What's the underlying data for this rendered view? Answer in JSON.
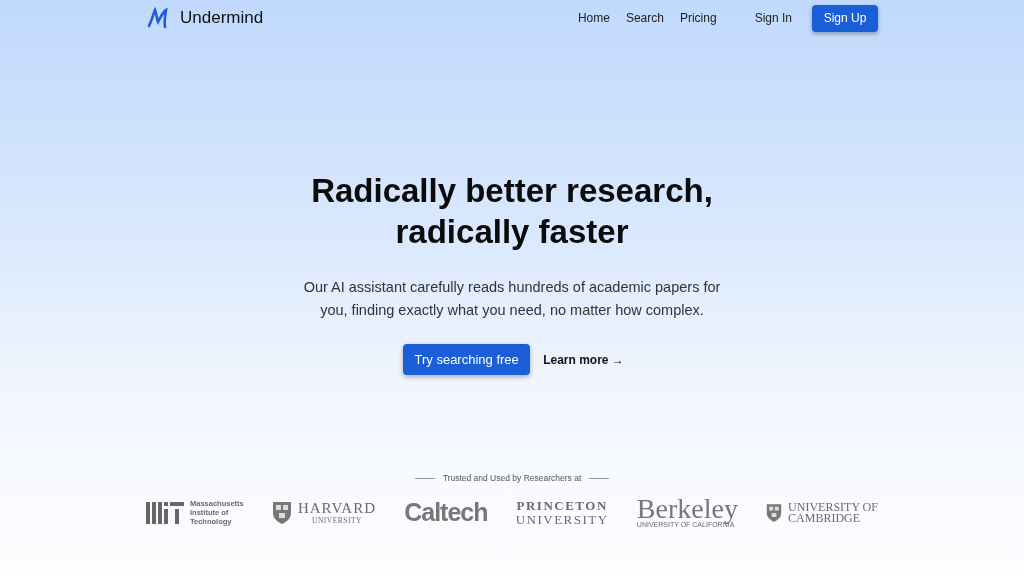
{
  "header": {
    "brand": "Undermind",
    "nav": [
      {
        "label": "Home"
      },
      {
        "label": "Search"
      },
      {
        "label": "Pricing"
      }
    ],
    "sign_in": "Sign In",
    "sign_up": "Sign Up"
  },
  "hero": {
    "title_lines": [
      "Radically better research,",
      "radically faster"
    ],
    "subtitle_lines": [
      "Our AI assistant carefully reads hundreds of academic papers for",
      "you, finding exactly what you need, no matter how complex."
    ],
    "primary_button": "Try searching free",
    "secondary_link": "Learn more →"
  },
  "trusted": {
    "caption": "Trusted and Used by Researchers at",
    "logos": [
      {
        "kind": "mit",
        "lines": [
          "Massachusetts",
          "Institute of",
          "Technology"
        ]
      },
      {
        "kind": "harvard",
        "lines": [
          "HARVARD",
          "UNIVERSITY"
        ]
      },
      {
        "kind": "caltech",
        "lines": [
          "Caltech"
        ]
      },
      {
        "kind": "princeton",
        "lines": [
          "PRINCETON",
          "UNIVERSITY"
        ]
      },
      {
        "kind": "berkeley",
        "lines": [
          "Berkeley",
          "UNIVERSITY OF CALIFORNIA"
        ]
      },
      {
        "kind": "cambridge",
        "lines": [
          "UNIVERSITY OF",
          "CAMBRIDGE"
        ]
      }
    ]
  }
}
